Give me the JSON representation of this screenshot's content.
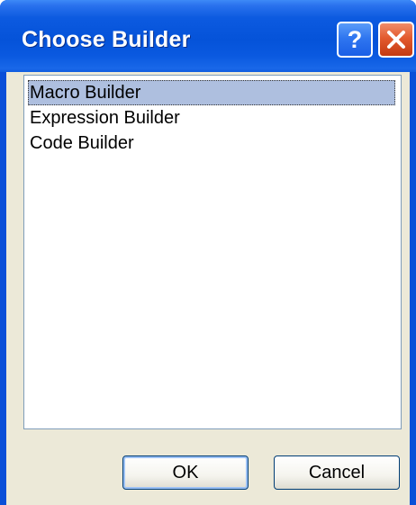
{
  "window": {
    "title": "Choose Builder",
    "help_glyph": "?",
    "close_icon": "close-icon"
  },
  "builder_list": {
    "items": [
      {
        "label": "Macro Builder",
        "selected": true
      },
      {
        "label": "Expression Builder",
        "selected": false
      },
      {
        "label": "Code Builder",
        "selected": false
      }
    ]
  },
  "buttons": {
    "ok_label": "OK",
    "cancel_label": "Cancel"
  },
  "colors": {
    "titlebar": "#0553d9",
    "close_button": "#e35a2e",
    "selection": "#aebfdf",
    "dialog_face": "#ece9d8"
  }
}
